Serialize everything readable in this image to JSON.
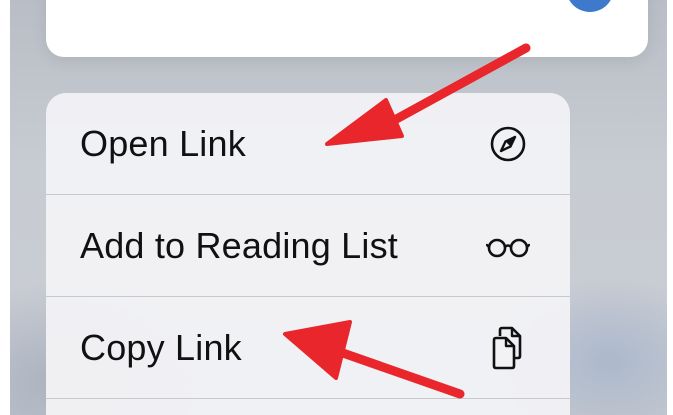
{
  "menu": {
    "items": [
      {
        "label": "Open Link",
        "icon": "compass-icon"
      },
      {
        "label": "Add to Reading List",
        "icon": "glasses-icon"
      },
      {
        "label": "Copy Link",
        "icon": "copy-icon"
      }
    ]
  },
  "annotations": {
    "arrow_color": "#e8262b"
  }
}
